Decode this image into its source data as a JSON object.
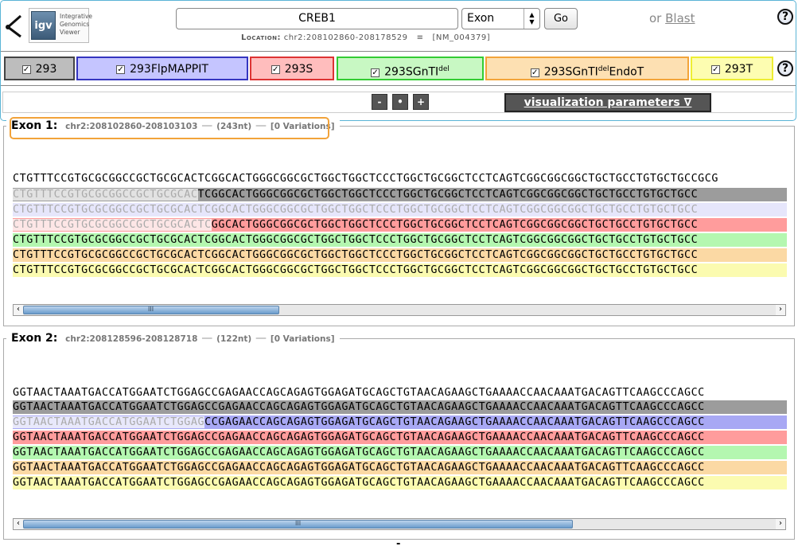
{
  "header": {
    "logo_text": [
      "Integrative",
      "Genomics",
      "Viewer"
    ],
    "logo_abbr": "igv",
    "search_value": "CREB1",
    "feature_type": "Exon",
    "go_label": "Go",
    "location_label": "Location:",
    "location_value": "chr2:208102860-208178529",
    "location_sep": "≡",
    "refseq": "[NM_004379]",
    "or_text": "or",
    "blast_label": "Blast",
    "help_glyph": "?"
  },
  "samples": [
    {
      "label": "293",
      "sup": "",
      "suffix": "",
      "bg": "#bdbdbd",
      "border": "#444"
    },
    {
      "label": "293FlpMAPPIT",
      "sup": "",
      "suffix": "",
      "bg": "#c5c5ff",
      "border": "#3535c0"
    },
    {
      "label": "293S",
      "sup": "",
      "suffix": "",
      "bg": "#ffbdbd",
      "border": "#d33"
    },
    {
      "label": "293SGnTI",
      "sup": "del",
      "suffix": "",
      "bg": "#c8f8c3",
      "border": "#3c3"
    },
    {
      "label": "293SGnTI",
      "sup": "del",
      "suffix": "EndoT",
      "bg": "#fde0b2",
      "border": "#f3a43a"
    },
    {
      "label": "293T",
      "sup": "",
      "suffix": "",
      "bg": "#fdfdb1",
      "border": "#ee3"
    }
  ],
  "zoom": {
    "minus": "-",
    "reset": "•",
    "plus": "+"
  },
  "vis_params": "visualization parameters ∇",
  "exon1": {
    "title": "Exon 1:",
    "coords": "chr2:208102860-208103103",
    "length": "(243nt)",
    "variations": "[0 Variations]",
    "ref": "CTGTTTCCGTGCGCGGCCGCTGCGCACTCGGCACTGGGCGGCGCTGGCTGGCTCCCTGGCTGCGGCTCCTCAGTCGGCGGCGGCTGCTGCCTGTGCTGCCGCG",
    "rows": [
      {
        "pre": "CTGTTTCCGTGCGCGGCCGCTGCGCAC",
        "seq": "TCGGCACTGGGCGGCGCTGGCTGGCTCCCTGGCTGCGGCTCCTCAGTCGGCGGCGGCTGCTGCCTGTGCTGCC",
        "bg": "#9c9c9c",
        "lightbg": "#e2e2e2"
      },
      {
        "pre": "CTGTTTCCGTGCGCGGCCGCTGCGCACTCGGCACTGGGCGGCGCTGGCTGGCTCCCTGGCTGCGGCTCCTCAGTCGGCGGCGGCTGCTGCCTGTGCTGCC",
        "seq": "",
        "bg": "#e6e6fb",
        "lightbg": "#e6e6fb"
      },
      {
        "pre": "CTGTTTCCGTGCGCGGCCGCTGCGCACTC",
        "seq": "GGCACTGGGCGGCGCTGGCTGGCTCCCTGGCTGCGGCTCCTCAGTCGGCGGCGGCTGCTGCCTGTGCTGCC",
        "bg": "#ff9c9c",
        "lightbg": "#fde6e6"
      },
      {
        "pre": "",
        "seq": "CTGTTTCCGTGCGCGGCCGCTGCGCACTCGGCACTGGGCGGCGCTGGCTGGCTCCCTGGCTGCGGCTCCTCAGTCGGCGGCGGCTGCTGCCTGTGCTGCC",
        "bg": "#b4f7b0",
        "lightbg": "#b4f7b0"
      },
      {
        "pre": "",
        "seq": "CTGTTTCCGTGCGCGGCCGCTGCGCACTCGGCACTGGGCGGCGCTGGCTGGCTCCCTGGCTGCGGCTCCTCAGTCGGCGGCGGCTGCTGCCTGTGCTGCC",
        "bg": "#fbd9a4",
        "lightbg": "#fbd9a4"
      },
      {
        "pre": "",
        "seq": "CTGTTTCCGTGCGCGGCCGCTGCGCACTCGGCACTGGGCGGCGCTGGCTGGCTCCCTGGCTGCGGCTCCTCAGTCGGCGGCGGCTGCTGCCTGTGCTGCC",
        "bg": "#fbfbb0",
        "lightbg": "#fbfbb0"
      }
    ],
    "scroll_pos": 0.34,
    "grip": "III",
    "left_arrow": "‹",
    "right_arrow": "›"
  },
  "exon2": {
    "title": "Exon 2:",
    "coords": "chr2:208128596-208128718",
    "length": "(122nt)",
    "variations": "[0 Variations]",
    "ref": "GGTAACTAAATGACCATGGAATCTGGAGCCGAGAACCAGCAGAGTGGAGATGCAGCTGTAACAGAAGCTGAAAACCAACAAATGACAGTTCAAGCCCAGCC",
    "rows": [
      {
        "pre": "",
        "seq": "GGTAACTAAATGACCATGGAATCTGGAGCCGAGAACCAGCAGAGTGGAGATGCAGCTGTAACAGAAGCTGAAAACCAACAAATGACAGTTCAAGCCCAGCC",
        "bg": "#9c9c9c",
        "lightbg": "#9c9c9c"
      },
      {
        "pre": "GGTAACTAAATGACCATGGAATCTGGAG",
        "seq": "CCGAGAACCAGCAGAGTGGAGATGCAGCTGTAACAGAAGCTGAAAACCAACAAATGACAGTTCAAGCCCAGCC",
        "bg": "#a8a8f4",
        "lightbg": "#e8e8fb"
      },
      {
        "pre": "",
        "seq": "GGTAACTAAATGACCATGGAATCTGGAGCCGAGAACCAGCAGAGTGGAGATGCAGCTGTAACAGAAGCTGAAAACCAACAAATGACAGTTCAAGCCCAGCC",
        "bg": "#ff9c9c",
        "lightbg": "#ff9c9c"
      },
      {
        "pre": "",
        "seq": "GGTAACTAAATGACCATGGAATCTGGAGCCGAGAACCAGCAGAGTGGAGATGCAGCTGTAACAGAAGCTGAAAACCAACAAATGACAGTTCAAGCCCAGCC",
        "bg": "#b4f7b0",
        "lightbg": "#b4f7b0"
      },
      {
        "pre": "",
        "seq": "GGTAACTAAATGACCATGGAATCTGGAGCCGAGAACCAGCAGAGTGGAGATGCAGCTGTAACAGAAGCTGAAAACCAACAAATGACAGTTCAAGCCCAGCC",
        "bg": "#fbd9a4",
        "lightbg": "#fbd9a4"
      },
      {
        "pre": "",
        "seq": "GGTAACTAAATGACCATGGAATCTGGAGCCGAGAACCAGCAGAGTGGAGATGCAGCTGTAACAGAAGCTGAAAACCAACAAATGACAGTTCAAGCCCAGCC",
        "bg": "#fbfbb0",
        "lightbg": "#fbfbb0"
      }
    ],
    "scroll_pos": 0.73,
    "grip": "III",
    "left_arrow": "‹",
    "right_arrow": "›"
  },
  "footer_mark": "-"
}
